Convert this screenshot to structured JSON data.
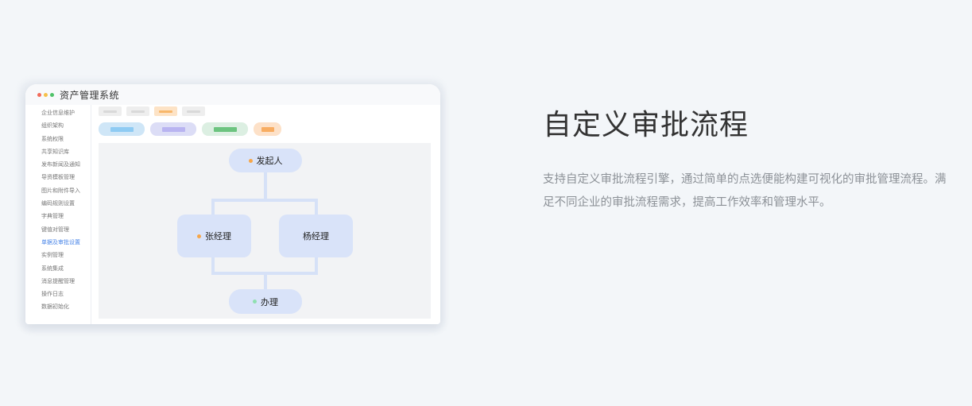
{
  "window": {
    "title": "资产管理系统",
    "controls": [
      "close-dot",
      "minimize-dot",
      "maximize-dot"
    ]
  },
  "sidebar": {
    "items": [
      {
        "label": "企业信息维护",
        "active": false
      },
      {
        "label": "组织架构",
        "active": false
      },
      {
        "label": "系统权限",
        "active": false
      },
      {
        "label": "共享知识库",
        "active": false
      },
      {
        "label": "发布新闻及通知",
        "active": false
      },
      {
        "label": "导资模板管理",
        "active": false
      },
      {
        "label": "图片和附件导入",
        "active": false
      },
      {
        "label": "编码规则设置",
        "active": false
      },
      {
        "label": "字典管理",
        "active": false
      },
      {
        "label": "键值对管理",
        "active": false
      },
      {
        "label": "单据及审批设置",
        "active": true
      },
      {
        "label": "实例管理",
        "active": false
      },
      {
        "label": "系统集成",
        "active": false
      },
      {
        "label": "消息提醒管理",
        "active": false
      },
      {
        "label": "操作日志",
        "active": false
      },
      {
        "label": "数据初始化",
        "active": false
      }
    ]
  },
  "toolbar": {
    "chips": [
      {
        "bg": "#eeeeee",
        "bar": "#d9d9d9"
      },
      {
        "bg": "#eeeeee",
        "bar": "#d9d9d9"
      },
      {
        "bg": "#fde3c6",
        "bar": "#f8b76a"
      },
      {
        "bg": "#eeeeee",
        "bar": "#d9d9d9"
      }
    ],
    "tags": [
      {
        "bg": "#cfe6f7",
        "bar": "#8ecbf3"
      },
      {
        "bg": "#dcddf6",
        "bar": "#b9b4f1"
      },
      {
        "bg": "#dcefe2",
        "bar": "#6cc47f"
      },
      {
        "bg": "#fde1c8",
        "bar": "#f8ad62"
      }
    ]
  },
  "flow": {
    "start": {
      "label": "发起人",
      "dot_color": "#f6a64a"
    },
    "branches": [
      {
        "label": "张经理",
        "dot_color": "#f6a64a"
      },
      {
        "label": "杨经理",
        "dot_color": ""
      }
    ],
    "end": {
      "label": "办理",
      "dot_color": "#8fe0b0"
    }
  },
  "feature": {
    "title": "自定义审批流程",
    "description": "支持自定义审批流程引擎，通过简单的点选便能构建可视化的审批管理流程。满足不同企业的审批流程需求，提高工作效率和管理水平。"
  }
}
